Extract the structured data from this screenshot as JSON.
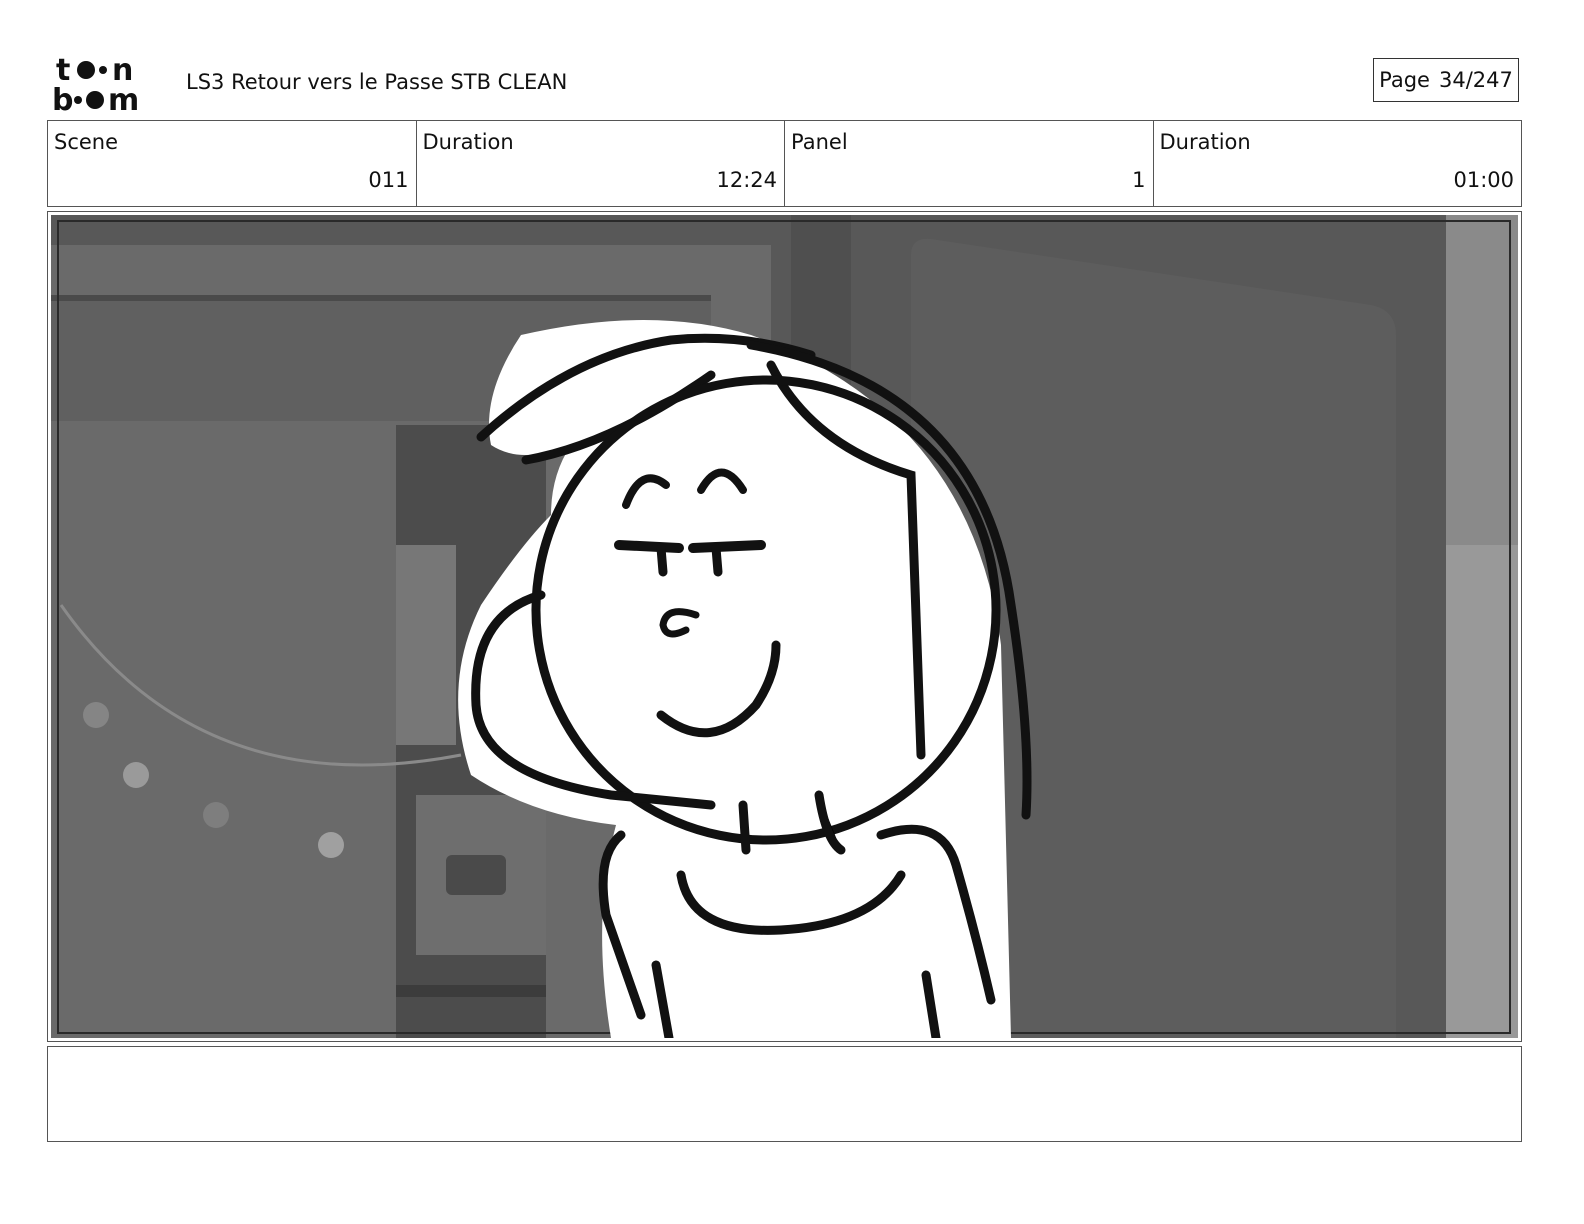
{
  "header": {
    "logo_top": "toon",
    "logo_bottom": "boom",
    "document_title": "LS3 Retour vers le Passe STB CLEAN",
    "page_label": "Page",
    "page_number": "34/247"
  },
  "info": {
    "scene_label": "Scene",
    "scene_value": "011",
    "scene_duration_label": "Duration",
    "scene_duration_value": "12:24",
    "panel_label": "Panel",
    "panel_value": "1",
    "panel_duration_label": "Duration",
    "panel_duration_value": "01:00"
  },
  "panel": {
    "icon": "storyboard-drawing-girl-smirking"
  },
  "notes": {
    "text": ""
  }
}
